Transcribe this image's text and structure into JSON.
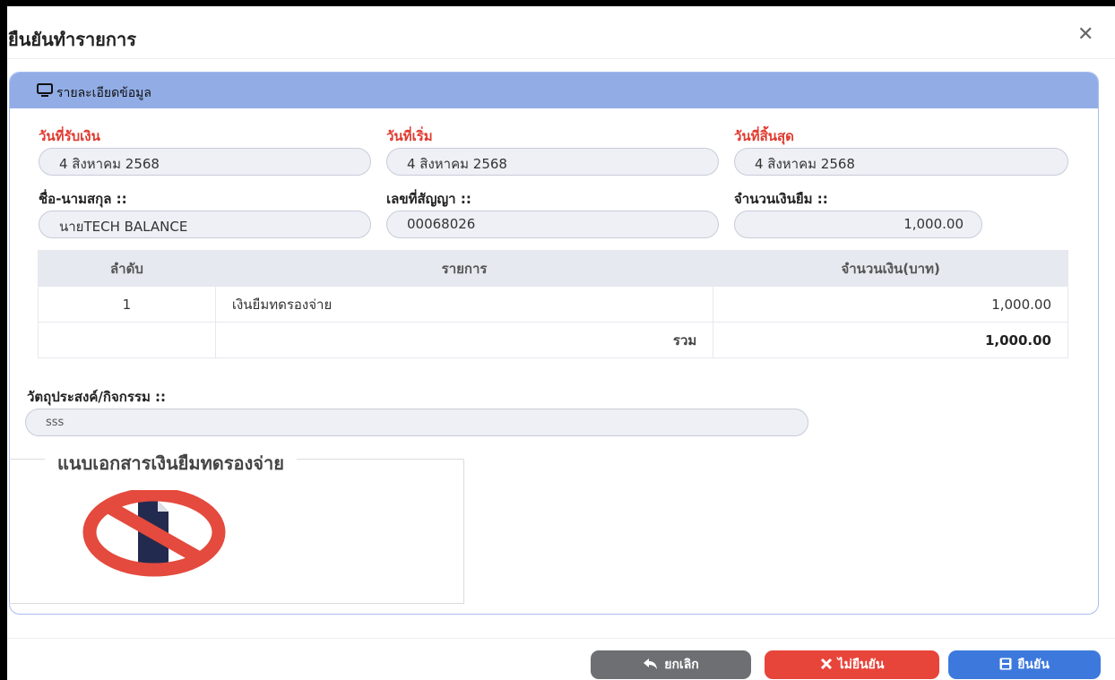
{
  "modal": {
    "title": "ยืนยันทำรายการ",
    "close_icon": "close-icon"
  },
  "panel": {
    "title": "รายละเอียดข้อมูล",
    "fields": {
      "receive_date": {
        "label": "วันที่รับเงิน",
        "value": "4 สิงหาคม 2568"
      },
      "start_date": {
        "label": "วันที่เริ่ม",
        "value": "4 สิงหาคม 2568"
      },
      "end_date": {
        "label": "วันที่สิ้นสุด",
        "value": "4 สิงหาคม 2568"
      },
      "name": {
        "label": "ชื่อ-นามสกุล ::",
        "value": "นายTECH  BALANCE"
      },
      "contract_no": {
        "label": "เลขที่สัญญา ::",
        "value": "00068026"
      },
      "loan_amount": {
        "label": "จำนวนเงินยืม ::",
        "value": "1,000.00"
      }
    },
    "table": {
      "headers": [
        "ลำดับ",
        "รายการ",
        "จำนวนเงิน(บาท)"
      ],
      "rows": [
        {
          "no": "1",
          "item": "เงินยืมทดรองจ่าย",
          "amount": "1,000.00"
        }
      ],
      "total_label": "รวม",
      "total_value": "1,000.00"
    },
    "purpose": {
      "label": "วัตถุประสงค์/กิจกรรม ::",
      "value": "sss"
    },
    "attachment": {
      "legend": "แนบเอกสารเงินยืมทดรองจ่าย"
    }
  },
  "buttons": {
    "cancel": "ยกเลิก",
    "reject": "ไม่ยืนยัน",
    "confirm": "ยืนยัน"
  },
  "colors": {
    "panel_header": "#92ade6",
    "label_red": "#e03a2f",
    "btn_gray": "#6e6f72",
    "btn_red": "#e8453a",
    "btn_blue": "#3d79dd"
  }
}
